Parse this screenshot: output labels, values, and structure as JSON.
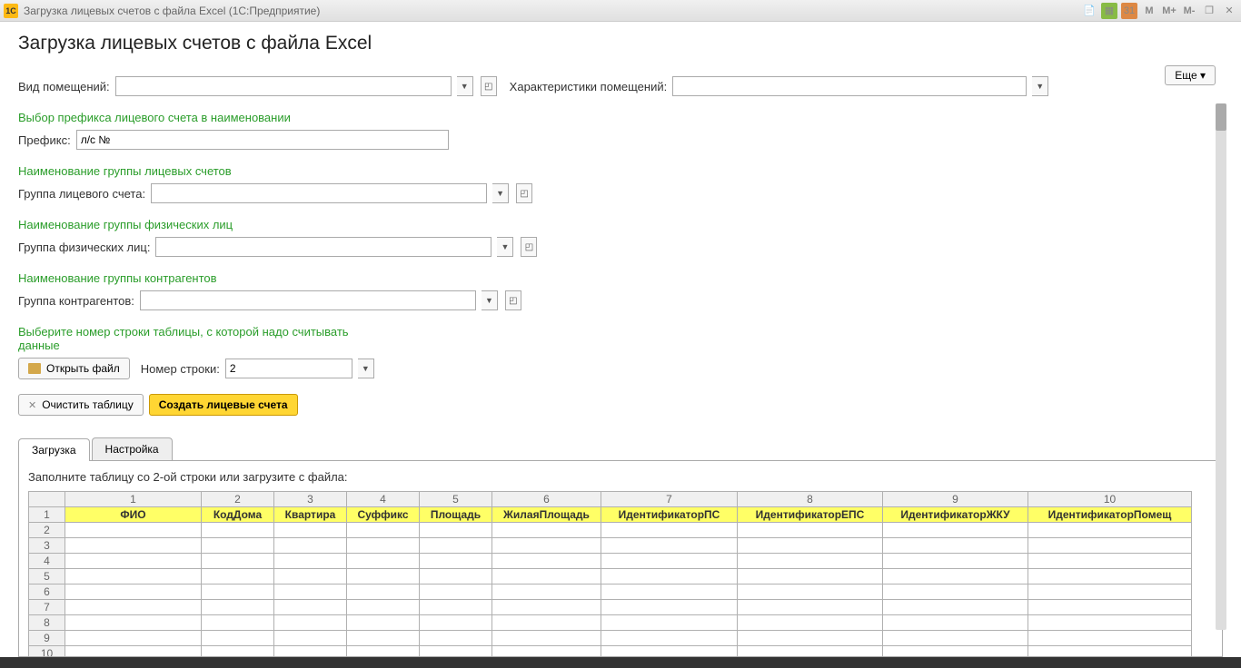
{
  "window": {
    "logo_text": "1C",
    "title": "Загрузка лицевых счетов с файла Excel  (1С:Предприятие)",
    "date_icon": "31"
  },
  "page": {
    "heading": "Загрузка лицевых счетов с файла Excel",
    "more_btn": "Еще ▾"
  },
  "fields": {
    "vid_label": "Вид помещений:",
    "char_label": "Характеристики помещений:",
    "prefix_section": "Выбор префикса лицевого счета в наименовании",
    "prefix_label": "Префикс:",
    "prefix_value": "л/с №",
    "group_ls_section": "Наименование группы лицевых счетов",
    "group_ls_label": "Группа лицевого счета:",
    "group_fl_section": "Наименование группы физических лиц",
    "group_fl_label": "Группа физических лиц:",
    "group_k_section": "Наименование группы контрагентов",
    "group_k_label": "Группа контрагентов:",
    "row_section": "Выберите номер строки таблицы, с которой надо считывать данные",
    "open_file_btn": "Открыть файл",
    "row_num_label": "Номер строки:",
    "row_num_value": "2",
    "clear_btn": "Очистить таблицу",
    "create_btn": "Создать лицевые счета"
  },
  "tabs": {
    "load": "Загрузка",
    "settings": "Настройка"
  },
  "table": {
    "hint": "Заполните таблицу со 2-ой строки или загрузите с файла:",
    "col_nums": [
      "1",
      "2",
      "3",
      "4",
      "5",
      "6",
      "7",
      "8",
      "9",
      "10"
    ],
    "headers": [
      "ФИО",
      "КодДома",
      "Квартира",
      "Суффикс",
      "Площадь",
      "ЖилаяПлощадь",
      "ИдентификаторПС",
      "ИдентификаторЕПС",
      "ИдентификаторЖКУ",
      "ИдентификаторПомещ"
    ],
    "row_nums": [
      "1",
      "2",
      "3",
      "4",
      "5",
      "6",
      "7",
      "8",
      "9",
      "10"
    ]
  }
}
